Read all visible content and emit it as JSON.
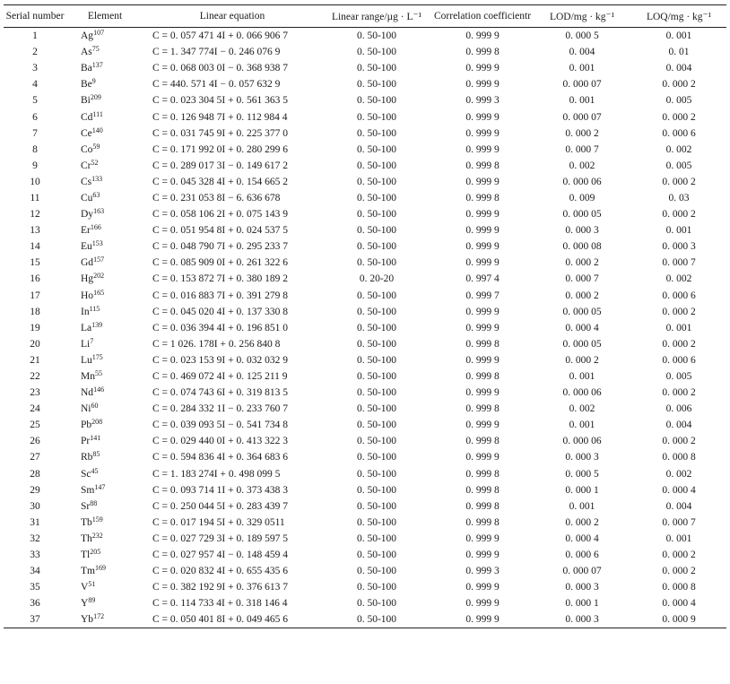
{
  "table": {
    "headers": [
      "Serial number",
      "Element",
      "Linear equation",
      "Linear range/µg · L⁻¹",
      "Correlation coefficientr",
      "LOD/mg · kg⁻¹",
      "LOQ/mg · kg⁻¹"
    ],
    "rows": [
      {
        "n": "1",
        "el": "Ag",
        "iso": "107",
        "eq": "C = 0. 057 471 4I + 0. 066 906 7",
        "range": "0. 50-100",
        "r": "0. 999 9",
        "lod": "0. 000 5",
        "loq": "0. 001"
      },
      {
        "n": "2",
        "el": "As",
        "iso": "75",
        "eq": "C = 1. 347 774I − 0. 246 076 9",
        "range": "0. 50-100",
        "r": "0. 999 8",
        "lod": "0. 004",
        "loq": "0. 01"
      },
      {
        "n": "3",
        "el": "Ba",
        "iso": "137",
        "eq": "C = 0. 068 003 0I − 0. 368 938 7",
        "range": "0. 50-100",
        "r": "0. 999 9",
        "lod": "0. 001",
        "loq": "0. 004"
      },
      {
        "n": "4",
        "el": "Be",
        "iso": "9",
        "eq": "C = 440. 571 4I − 0. 057 632 9",
        "range": "0. 50-100",
        "r": "0. 999 9",
        "lod": "0. 000 07",
        "loq": "0. 000 2"
      },
      {
        "n": "5",
        "el": "Bi",
        "iso": "209",
        "eq": "C = 0. 023 304 5I + 0. 561 363 5",
        "range": "0. 50-100",
        "r": "0. 999 3",
        "lod": "0. 001",
        "loq": "0. 005"
      },
      {
        "n": "6",
        "el": "Cd",
        "iso": "111",
        "eq": "C = 0. 126 948 7I + 0. 112 984 4",
        "range": "0. 50-100",
        "r": "0. 999 9",
        "lod": "0. 000 07",
        "loq": "0. 000 2"
      },
      {
        "n": "7",
        "el": "Ce",
        "iso": "140",
        "eq": "C = 0. 031 745 9I + 0. 225 377 0",
        "range": "0. 50-100",
        "r": "0. 999 9",
        "lod": "0. 000 2",
        "loq": "0. 000 6"
      },
      {
        "n": "8",
        "el": "Co",
        "iso": "59",
        "eq": "C = 0. 171 992 0I + 0. 280 299 6",
        "range": "0. 50-100",
        "r": "0. 999 9",
        "lod": "0. 000 7",
        "loq": "0. 002"
      },
      {
        "n": "9",
        "el": "Cr",
        "iso": "52",
        "eq": "C = 0. 289 017 3I − 0. 149 617 2",
        "range": "0. 50-100",
        "r": "0. 999 8",
        "lod": "0. 002",
        "loq": "0. 005"
      },
      {
        "n": "10",
        "el": "Cs",
        "iso": "133",
        "eq": "C = 0. 045 328 4I + 0. 154 665 2",
        "range": "0. 50-100",
        "r": "0. 999 9",
        "lod": "0. 000 06",
        "loq": "0. 000 2"
      },
      {
        "n": "11",
        "el": "Cu",
        "iso": "63",
        "eq": "C = 0. 231 053 8I − 6. 636 678",
        "range": "0. 50-100",
        "r": "0. 999 8",
        "lod": "0. 009",
        "loq": "0. 03"
      },
      {
        "n": "12",
        "el": "Dy",
        "iso": "163",
        "eq": "C = 0. 058 106 2I + 0. 075 143 9",
        "range": "0. 50-100",
        "r": "0. 999 9",
        "lod": "0. 000 05",
        "loq": "0. 000 2"
      },
      {
        "n": "13",
        "el": "Er",
        "iso": "166",
        "eq": "C = 0. 051 954 8I + 0. 024 537 5",
        "range": "0. 50-100",
        "r": "0. 999 9",
        "lod": "0. 000 3",
        "loq": "0. 001"
      },
      {
        "n": "14",
        "el": "Eu",
        "iso": "153",
        "eq": "C = 0. 048 790 7I + 0. 295 233 7",
        "range": "0. 50-100",
        "r": "0. 999 9",
        "lod": "0. 000 08",
        "loq": "0. 000 3"
      },
      {
        "n": "15",
        "el": "Gd",
        "iso": "157",
        "eq": "C = 0. 085 909 0I + 0. 261 322 6",
        "range": "0. 50-100",
        "r": "0. 999 9",
        "lod": "0. 000 2",
        "loq": "0. 000 7"
      },
      {
        "n": "16",
        "el": "Hg",
        "iso": "202",
        "eq": "C = 0. 153 872 7I + 0. 380 189 2",
        "range": "0. 20-20",
        "r": "0. 997 4",
        "lod": "0. 000 7",
        "loq": "0. 002"
      },
      {
        "n": "17",
        "el": "Ho",
        "iso": "165",
        "eq": "C = 0. 016 883 7I + 0. 391 279 8",
        "range": "0. 50-100",
        "r": "0. 999 7",
        "lod": "0. 000 2",
        "loq": "0. 000 6"
      },
      {
        "n": "18",
        "el": "In",
        "iso": "115",
        "eq": "C = 0. 045 020 4I + 0. 137 330 8",
        "range": "0. 50-100",
        "r": "0. 999 9",
        "lod": "0. 000 05",
        "loq": "0. 000 2"
      },
      {
        "n": "19",
        "el": "La",
        "iso": "139",
        "eq": "C = 0. 036 394 4I + 0. 196 851 0",
        "range": "0. 50-100",
        "r": "0. 999 9",
        "lod": "0. 000 4",
        "loq": "0. 001"
      },
      {
        "n": "20",
        "el": "Li",
        "iso": "7",
        "eq": "C = 1 026. 178I + 0. 256 840 8",
        "range": "0. 50-100",
        "r": "0. 999 8",
        "lod": "0. 000 05",
        "loq": "0. 000 2"
      },
      {
        "n": "21",
        "el": "Lu",
        "iso": "175",
        "eq": "C = 0. 023 153 9I + 0. 032 032 9",
        "range": "0. 50-100",
        "r": "0. 999 9",
        "lod": "0. 000 2",
        "loq": "0. 000 6"
      },
      {
        "n": "22",
        "el": "Mn",
        "iso": "55",
        "eq": "C = 0. 469 072 4I + 0. 125 211 9",
        "range": "0. 50-100",
        "r": "0. 999 8",
        "lod": "0. 001",
        "loq": "0. 005"
      },
      {
        "n": "23",
        "el": "Nd",
        "iso": "146",
        "eq": "C = 0. 074 743 6I + 0. 319 813 5",
        "range": "0. 50-100",
        "r": "0. 999 9",
        "lod": "0. 000 06",
        "loq": "0. 000 2"
      },
      {
        "n": "24",
        "el": "Ni",
        "iso": "60",
        "eq": "C = 0. 284 332 1I − 0. 233 760 7",
        "range": "0. 50-100",
        "r": "0. 999 8",
        "lod": "0. 002",
        "loq": "0. 006"
      },
      {
        "n": "25",
        "el": "Pb",
        "iso": "208",
        "eq": "C = 0. 039 093 5I − 0. 541 734 8",
        "range": "0. 50-100",
        "r": "0. 999 9",
        "lod": "0. 001",
        "loq": "0. 004"
      },
      {
        "n": "26",
        "el": "Pr",
        "iso": "141",
        "eq": "C = 0. 029 440 0I + 0. 413 322 3",
        "range": "0. 50-100",
        "r": "0. 999 8",
        "lod": "0. 000 06",
        "loq": "0. 000 2"
      },
      {
        "n": "27",
        "el": "Rb",
        "iso": "85",
        "eq": "C = 0. 594 836 4I + 0. 364 683 6",
        "range": "0. 50-100",
        "r": "0. 999 9",
        "lod": "0. 000 3",
        "loq": "0. 000 8"
      },
      {
        "n": "28",
        "el": "Sc",
        "iso": "45",
        "eq": "C = 1. 183 274I + 0. 498 099 5",
        "range": "0. 50-100",
        "r": "0. 999 8",
        "lod": "0. 000 5",
        "loq": "0. 002"
      },
      {
        "n": "29",
        "el": "Sm",
        "iso": "147",
        "eq": "C = 0. 093 714 1I + 0. 373 438 3",
        "range": "0. 50-100",
        "r": "0. 999 8",
        "lod": "0. 000 1",
        "loq": "0. 000 4"
      },
      {
        "n": "30",
        "el": "Sr",
        "iso": "88",
        "eq": "C = 0. 250 044 5I + 0. 283 439 7",
        "range": "0. 50-100",
        "r": "0. 999 8",
        "lod": "0. 001",
        "loq": "0. 004"
      },
      {
        "n": "31",
        "el": "Tb",
        "iso": "159",
        "eq": "C = 0. 017 194 5I + 0. 329 0511",
        "range": "0. 50-100",
        "r": "0. 999 8",
        "lod": "0. 000 2",
        "loq": "0. 000 7"
      },
      {
        "n": "32",
        "el": "Th",
        "iso": "232",
        "eq": "C = 0. 027 729 3I + 0. 189 597 5",
        "range": "0. 50-100",
        "r": "0. 999 9",
        "lod": "0. 000 4",
        "loq": "0. 001"
      },
      {
        "n": "33",
        "el": "Tl",
        "iso": "205",
        "eq": "C = 0. 027 957 4I − 0. 148 459 4",
        "range": "0. 50-100",
        "r": "0. 999 9",
        "lod": "0. 000 6",
        "loq": "0. 000 2"
      },
      {
        "n": "34",
        "el": "Tm",
        "iso": "169",
        "eq": "C = 0. 020 832 4I + 0. 655 435 6",
        "range": "0. 50-100",
        "r": "0. 999 3",
        "lod": "0. 000 07",
        "loq": "0. 000 2"
      },
      {
        "n": "35",
        "el": "V",
        "iso": "51",
        "eq": "C = 0. 382 192 9I + 0. 376 613 7",
        "range": "0. 50-100",
        "r": "0. 999 9",
        "lod": "0. 000 3",
        "loq": "0. 000 8"
      },
      {
        "n": "36",
        "el": "Y",
        "iso": "89",
        "eq": "C = 0. 114 733 4I + 0. 318 146 4",
        "range": "0. 50-100",
        "r": "0. 999 9",
        "lod": "0. 000 1",
        "loq": "0. 000 4"
      },
      {
        "n": "37",
        "el": "Yb",
        "iso": "172",
        "eq": "C = 0. 050 401 8I + 0. 049 465 6",
        "range": "0. 50-100",
        "r": "0. 999 9",
        "lod": "0. 000 3",
        "loq": "0. 000 9"
      }
    ]
  }
}
